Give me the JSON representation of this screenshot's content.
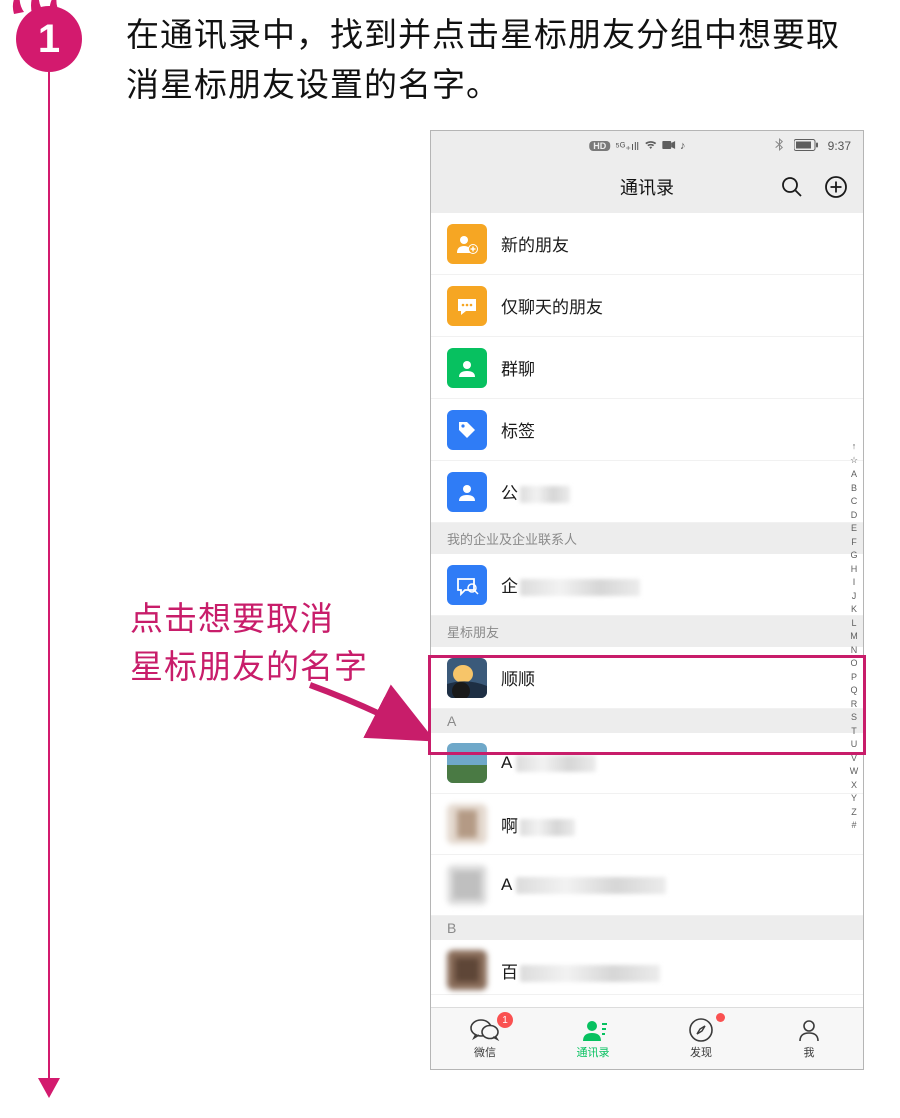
{
  "step": {
    "number": "1",
    "text": "在通讯录中，找到并点击星标朋友分组中想要取消星标朋友设置的名字。"
  },
  "callout": {
    "line1": "点击想要取消",
    "line2": "星标朋友的名字"
  },
  "statusbar": {
    "time": "9:37",
    "hd": "HD"
  },
  "header": {
    "title": "通讯录"
  },
  "menu": {
    "newFriends": "新的朋友",
    "chatOnly": "仅聊天的朋友",
    "groups": "群聊",
    "tags": "标签",
    "official": "公"
  },
  "sections": {
    "enterprise": "我的企业及企业联系人",
    "enterpriseItemPrefix": "企",
    "starred": "星标朋友",
    "starredContact": "顺顺",
    "a": "A",
    "aItem1": "A",
    "aItem2": "啊",
    "aItem3": "A",
    "b": "B",
    "bItem1": "百"
  },
  "indexStrip": [
    "↑",
    "☆",
    "A",
    "B",
    "C",
    "D",
    "E",
    "F",
    "G",
    "H",
    "I",
    "J",
    "K",
    "L",
    "M",
    "N",
    "O",
    "P",
    "Q",
    "R",
    "S",
    "T",
    "U",
    "V",
    "W",
    "X",
    "Y",
    "Z",
    "#"
  ],
  "tabs": {
    "wechat": "微信",
    "wechatBadge": "1",
    "contacts": "通讯录",
    "discover": "发现",
    "me": "我"
  }
}
